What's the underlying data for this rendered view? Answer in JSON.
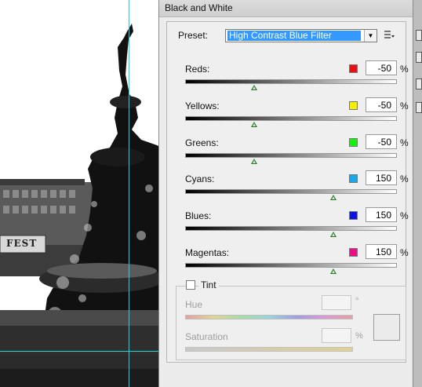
{
  "dialog": {
    "title": "Black and White"
  },
  "preset": {
    "label": "Preset:",
    "value": "High Contrast Blue Filter",
    "menu_icon": "list-menu-icon"
  },
  "sliders": [
    {
      "label": "Reds:",
      "value": "-50",
      "unit": "%",
      "color": "#e81010",
      "level": 0.326
    },
    {
      "label": "Yellows:",
      "value": "-50",
      "unit": "%",
      "color": "#f4ef00",
      "level": 0.326
    },
    {
      "label": "Greens:",
      "value": "-50",
      "unit": "%",
      "color": "#16f00e",
      "level": 0.326
    },
    {
      "label": "Cyans:",
      "value": "150",
      "unit": "%",
      "color": "#17a8e8",
      "level": 0.7
    },
    {
      "label": "Blues:",
      "value": "150",
      "unit": "%",
      "color": "#0b14e0",
      "level": 0.7
    },
    {
      "label": "Magentas:",
      "value": "150",
      "unit": "%",
      "color": "#ea0f88",
      "level": 0.7
    }
  ],
  "tint": {
    "label": "Tint",
    "checked": false,
    "hue_label": "Hue",
    "hue_unit": "°",
    "saturation_label": "Saturation",
    "saturation_unit": "%"
  },
  "canvas": {
    "sign_text": "FEST"
  }
}
